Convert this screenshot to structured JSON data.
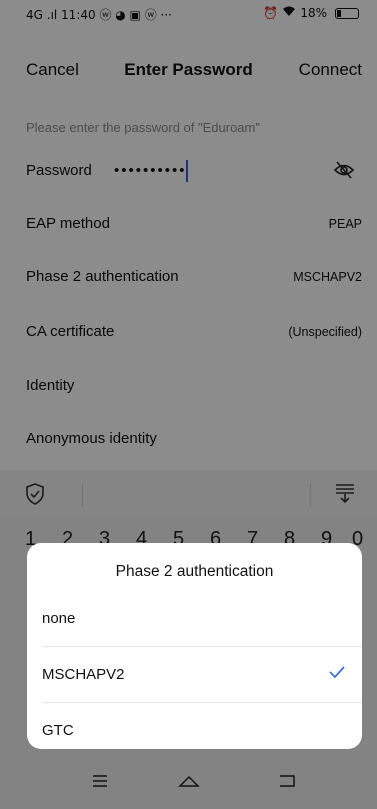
{
  "status_bar": {
    "left": "4G .ıl 11:40 ⓦ ◕ ▣ ⓦ ···",
    "battery": "18%",
    "battery_level": 0.18
  },
  "header": {
    "cancel": "Cancel",
    "title": "Enter Password",
    "connect": "Connect"
  },
  "hint": "Please enter the password of \"Eduroam\"",
  "password": {
    "label": "Password",
    "value": "••••••••••"
  },
  "rows": [
    {
      "label": "EAP method",
      "value": "PEAP"
    },
    {
      "label": "Phase 2 authentication",
      "value": "MSCHAPV2"
    },
    {
      "label": "CA certificate",
      "value": "(Unspecified)"
    },
    {
      "label": "Identity",
      "value": ""
    },
    {
      "label": "Anonymous identity",
      "value": ""
    }
  ],
  "keyboard": {
    "numbers": [
      "1",
      "2",
      "3",
      "4",
      "5",
      "6",
      "7",
      "8",
      "9",
      "0"
    ]
  },
  "dialog": {
    "title": "Phase 2 authentication",
    "options": [
      {
        "label": "none",
        "selected": false
      },
      {
        "label": "MSCHAPV2",
        "selected": true
      },
      {
        "label": "GTC",
        "selected": false
      }
    ],
    "accent_color": "#3b6fd6"
  },
  "icons": {
    "eye": "eye-off-icon",
    "shield": "shield-check-icon",
    "collapse": "keyboard-collapse-icon",
    "menu": "menu-icon",
    "home": "home-icon",
    "back": "back-icon"
  }
}
